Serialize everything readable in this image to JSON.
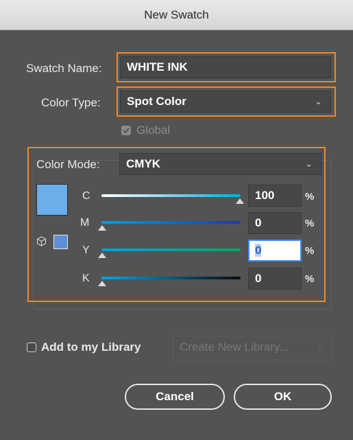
{
  "window": {
    "title": "New Swatch"
  },
  "swatch_name": {
    "label": "Swatch Name:",
    "value": "WHITE INK"
  },
  "color_type": {
    "label": "Color Type:",
    "value": "Spot Color",
    "chevron": "⌄"
  },
  "global": {
    "label": "Global",
    "checked": true,
    "enabled": false
  },
  "color_mode": {
    "label": "Color Mode:",
    "value": "CMYK",
    "chevron": "⌄"
  },
  "swatch_preview": {
    "color": "#6aaeea"
  },
  "gamut": {
    "icon": "cube-icon",
    "color": "#5f8fd6"
  },
  "channels": [
    {
      "label": "C",
      "value": "100",
      "unit": "%",
      "level": 1.0
    },
    {
      "label": "M",
      "value": "0",
      "unit": "%",
      "level": 0.0
    },
    {
      "label": "Y",
      "value": "0",
      "unit": "%",
      "level": 0.0
    },
    {
      "label": "K",
      "value": "0",
      "unit": "%",
      "level": 0.0
    }
  ],
  "library": {
    "label": "Add to my Library",
    "checked": false,
    "select_placeholder": "Create New Library...",
    "chevron": "⌄"
  },
  "buttons": {
    "cancel": "Cancel",
    "ok": "OK"
  },
  "colors": {
    "accent_outline": "#f08a24",
    "focus": "#3f8ef5",
    "dialog_bg": "#535353"
  }
}
